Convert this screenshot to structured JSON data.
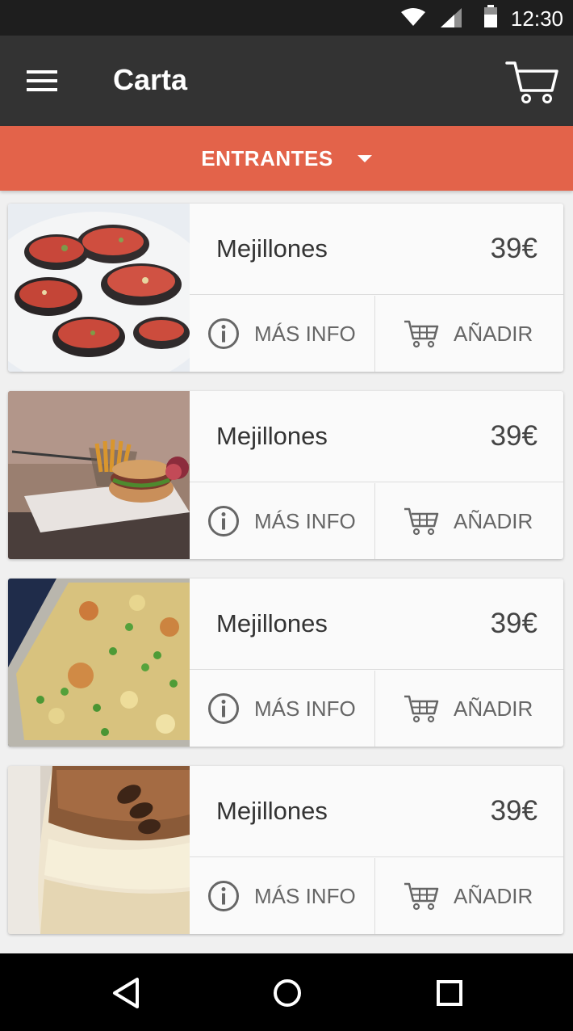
{
  "status_bar": {
    "time": "12:30"
  },
  "app_bar": {
    "title": "Carta"
  },
  "category": {
    "label": "ENTRANTES"
  },
  "items": [
    {
      "name": "Mejillones",
      "price": "39€",
      "info_label": "MÁS INFO",
      "add_label": "AÑADIR"
    },
    {
      "name": "Mejillones",
      "price": "39€",
      "info_label": "MÁS INFO",
      "add_label": "AÑADIR"
    },
    {
      "name": "Mejillones",
      "price": "39€",
      "info_label": "MÁS INFO",
      "add_label": "AÑADIR"
    },
    {
      "name": "Mejillones",
      "price": "39€",
      "info_label": "MÁS INFO",
      "add_label": "AÑADIR"
    }
  ],
  "colors": {
    "accent": "#e3634a",
    "app_bar": "#333333",
    "status_bar": "#1e1e1e"
  },
  "icons": [
    "wifi-icon",
    "signal-icon",
    "battery-icon",
    "menu-icon",
    "cart-icon",
    "info-icon",
    "add-to-cart-icon",
    "back-icon",
    "home-icon",
    "recents-icon"
  ]
}
